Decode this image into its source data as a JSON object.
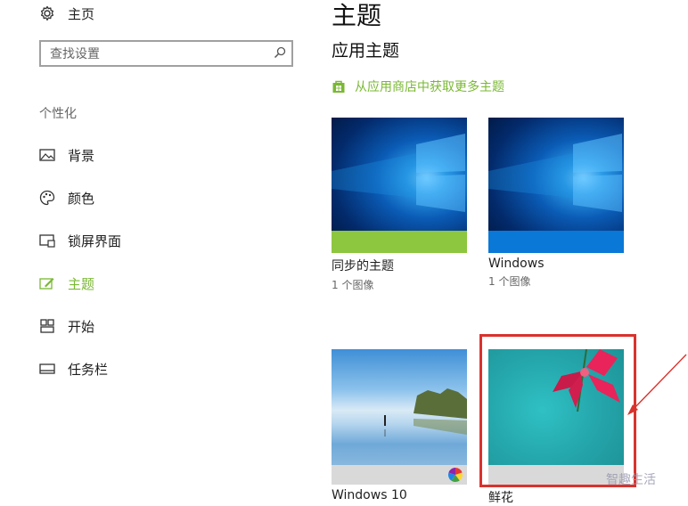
{
  "sidebar": {
    "home_label": "主页",
    "search_placeholder": "查找设置",
    "section_title": "个性化",
    "items": [
      {
        "label": "背景",
        "icon": "picture-icon"
      },
      {
        "label": "颜色",
        "icon": "palette-icon"
      },
      {
        "label": "锁屏界面",
        "icon": "lock-screen-icon"
      },
      {
        "label": "主题",
        "icon": "brush-icon",
        "active": true
      },
      {
        "label": "开始",
        "icon": "start-grid-icon"
      },
      {
        "label": "任务栏",
        "icon": "taskbar-icon"
      }
    ]
  },
  "main": {
    "title": "主题",
    "subtitle": "应用主题",
    "store_link": "从应用商店中获取更多主题",
    "themes": [
      {
        "name": "同步的主题",
        "count": "1 个图像",
        "bar_color": "#8dc63f"
      },
      {
        "name": "Windows",
        "count": "1 个图像",
        "bar_color": "#0a78d7"
      },
      {
        "name": "Windows 10",
        "count": ""
      },
      {
        "name": "鲜花",
        "count": ""
      }
    ]
  },
  "watermark": "智趣生活",
  "colors": {
    "accent": "#7ab833",
    "highlight_border": "#d9322d"
  }
}
